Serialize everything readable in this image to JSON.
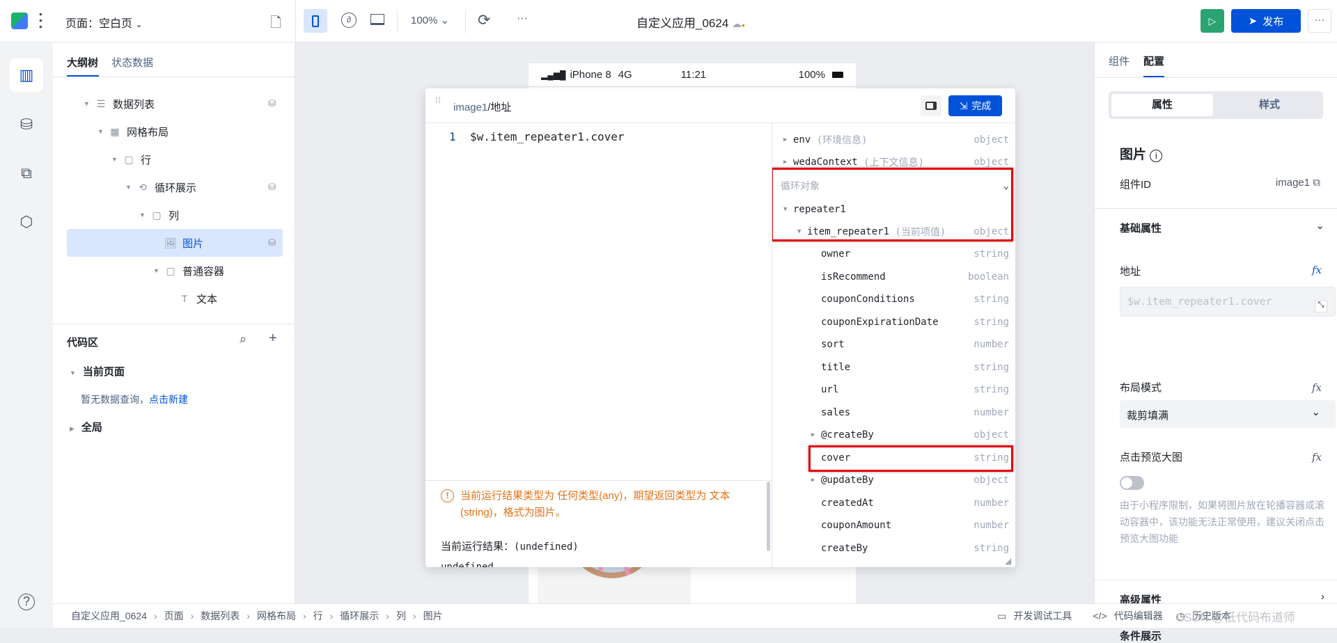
{
  "topbar": {
    "page_label": "页面：空白页",
    "zoom": "100%",
    "app_title": "自定义应用_0624",
    "publish": "发布",
    "more": "···"
  },
  "left": {
    "tabs": [
      "大纲树",
      "状态数据"
    ],
    "tree": [
      {
        "label": "数据列表",
        "icon": "list-icon",
        "level": 0,
        "arrow": true,
        "db": true
      },
      {
        "label": "网格布局",
        "icon": "grid-icon",
        "level": 1,
        "arrow": true,
        "db": false
      },
      {
        "label": "行",
        "icon": "box-icon",
        "level": 2,
        "arrow": true,
        "db": false
      },
      {
        "label": "循环展示",
        "icon": "loop-icon",
        "level": 3,
        "arrow": true,
        "db": true
      },
      {
        "label": "列",
        "icon": "box-icon",
        "level": 4,
        "arrow": true,
        "db": false
      },
      {
        "label": "图片",
        "icon": "image-icon",
        "level": 5,
        "arrow": false,
        "db": true,
        "selected": true
      },
      {
        "label": "普通容器",
        "icon": "box-icon",
        "level": 5,
        "arrow": true,
        "db": false
      },
      {
        "label": "文本",
        "icon": "text-icon",
        "level": 6,
        "arrow": false,
        "db": false
      }
    ],
    "code_title": "代码区",
    "current_page": "当前页面",
    "empty_text": "暂无数据查询，",
    "create_link": "点击新建",
    "global": "全局"
  },
  "phone": {
    "device": "iPhone 8",
    "network": "4G",
    "time": "11:21",
    "battery": "100%"
  },
  "dialog": {
    "path_prefix": "image1",
    "path_sep": "/",
    "path_name": "地址",
    "done": "完成",
    "line_no": "1",
    "code": "$w.item_repeater1.cover",
    "warning": "当前运行结果类型为 任何类型(any)，期望返回类型为 文本(string)，格式为图片。",
    "result_label": "当前运行结果：",
    "result_value": "(undefined)",
    "result_text": "undefined",
    "vars_top": [
      {
        "name": "env",
        "note": "(环境信息)",
        "type": "object"
      },
      {
        "name": "wedaContext",
        "note": "(上下文信息)",
        "type": "object"
      }
    ],
    "loop_title": "循环对象",
    "repeater": "repeater1",
    "item": {
      "name": "item_repeater1",
      "note": "(当前项值)",
      "type": "object"
    },
    "fields": [
      {
        "name": "owner",
        "type": "string"
      },
      {
        "name": "isRecommend",
        "type": "boolean"
      },
      {
        "name": "couponConditions",
        "type": "string"
      },
      {
        "name": "couponExpirationDate",
        "type": "string"
      },
      {
        "name": "sort",
        "type": "number"
      },
      {
        "name": "title",
        "type": "string"
      },
      {
        "name": "url",
        "type": "string"
      },
      {
        "name": "sales",
        "type": "number"
      },
      {
        "name": "@createBy",
        "type": "object",
        "arrow": true
      },
      {
        "name": "cover",
        "type": "string",
        "highlight": true
      },
      {
        "name": "@updateBy",
        "type": "object",
        "arrow": true
      },
      {
        "name": "createdAt",
        "type": "number"
      },
      {
        "name": "couponAmount",
        "type": "number"
      },
      {
        "name": "createBy",
        "type": "string"
      }
    ]
  },
  "right": {
    "tabs": [
      "组件",
      "配置"
    ],
    "seg": [
      "属性",
      "样式"
    ],
    "comp_title": "图片",
    "comp_id_label": "组件ID",
    "comp_id": "image1",
    "basic": "基础属性",
    "addr_label": "地址",
    "addr_value": "$w.item_repeater1.cover",
    "layout_label": "布局模式",
    "layout_value": "裁剪填满",
    "preview_label": "点击预览大图",
    "preview_on": false,
    "preview_hint": "由于小程序限制，如果将图片放在轮播容器或滚动容器中，该功能无法正常使用，建议关闭点击预览大图功能",
    "advanced": "高级属性",
    "condition": "条件展示"
  },
  "bottom": {
    "crumbs": [
      "自定义应用_0624",
      "页面",
      "数据列表",
      "网格布局",
      "行",
      "循环展示",
      "列",
      "图片"
    ],
    "devtools": "开发调试工具",
    "code_editor": "代码编辑器",
    "history": "历史版本",
    "watermark": "CSDN @低代码布道师"
  },
  "colors": {
    "accent": "#0052d9",
    "warning": "#e37318",
    "highlight": "#e5000f",
    "run": "#2ba471"
  }
}
